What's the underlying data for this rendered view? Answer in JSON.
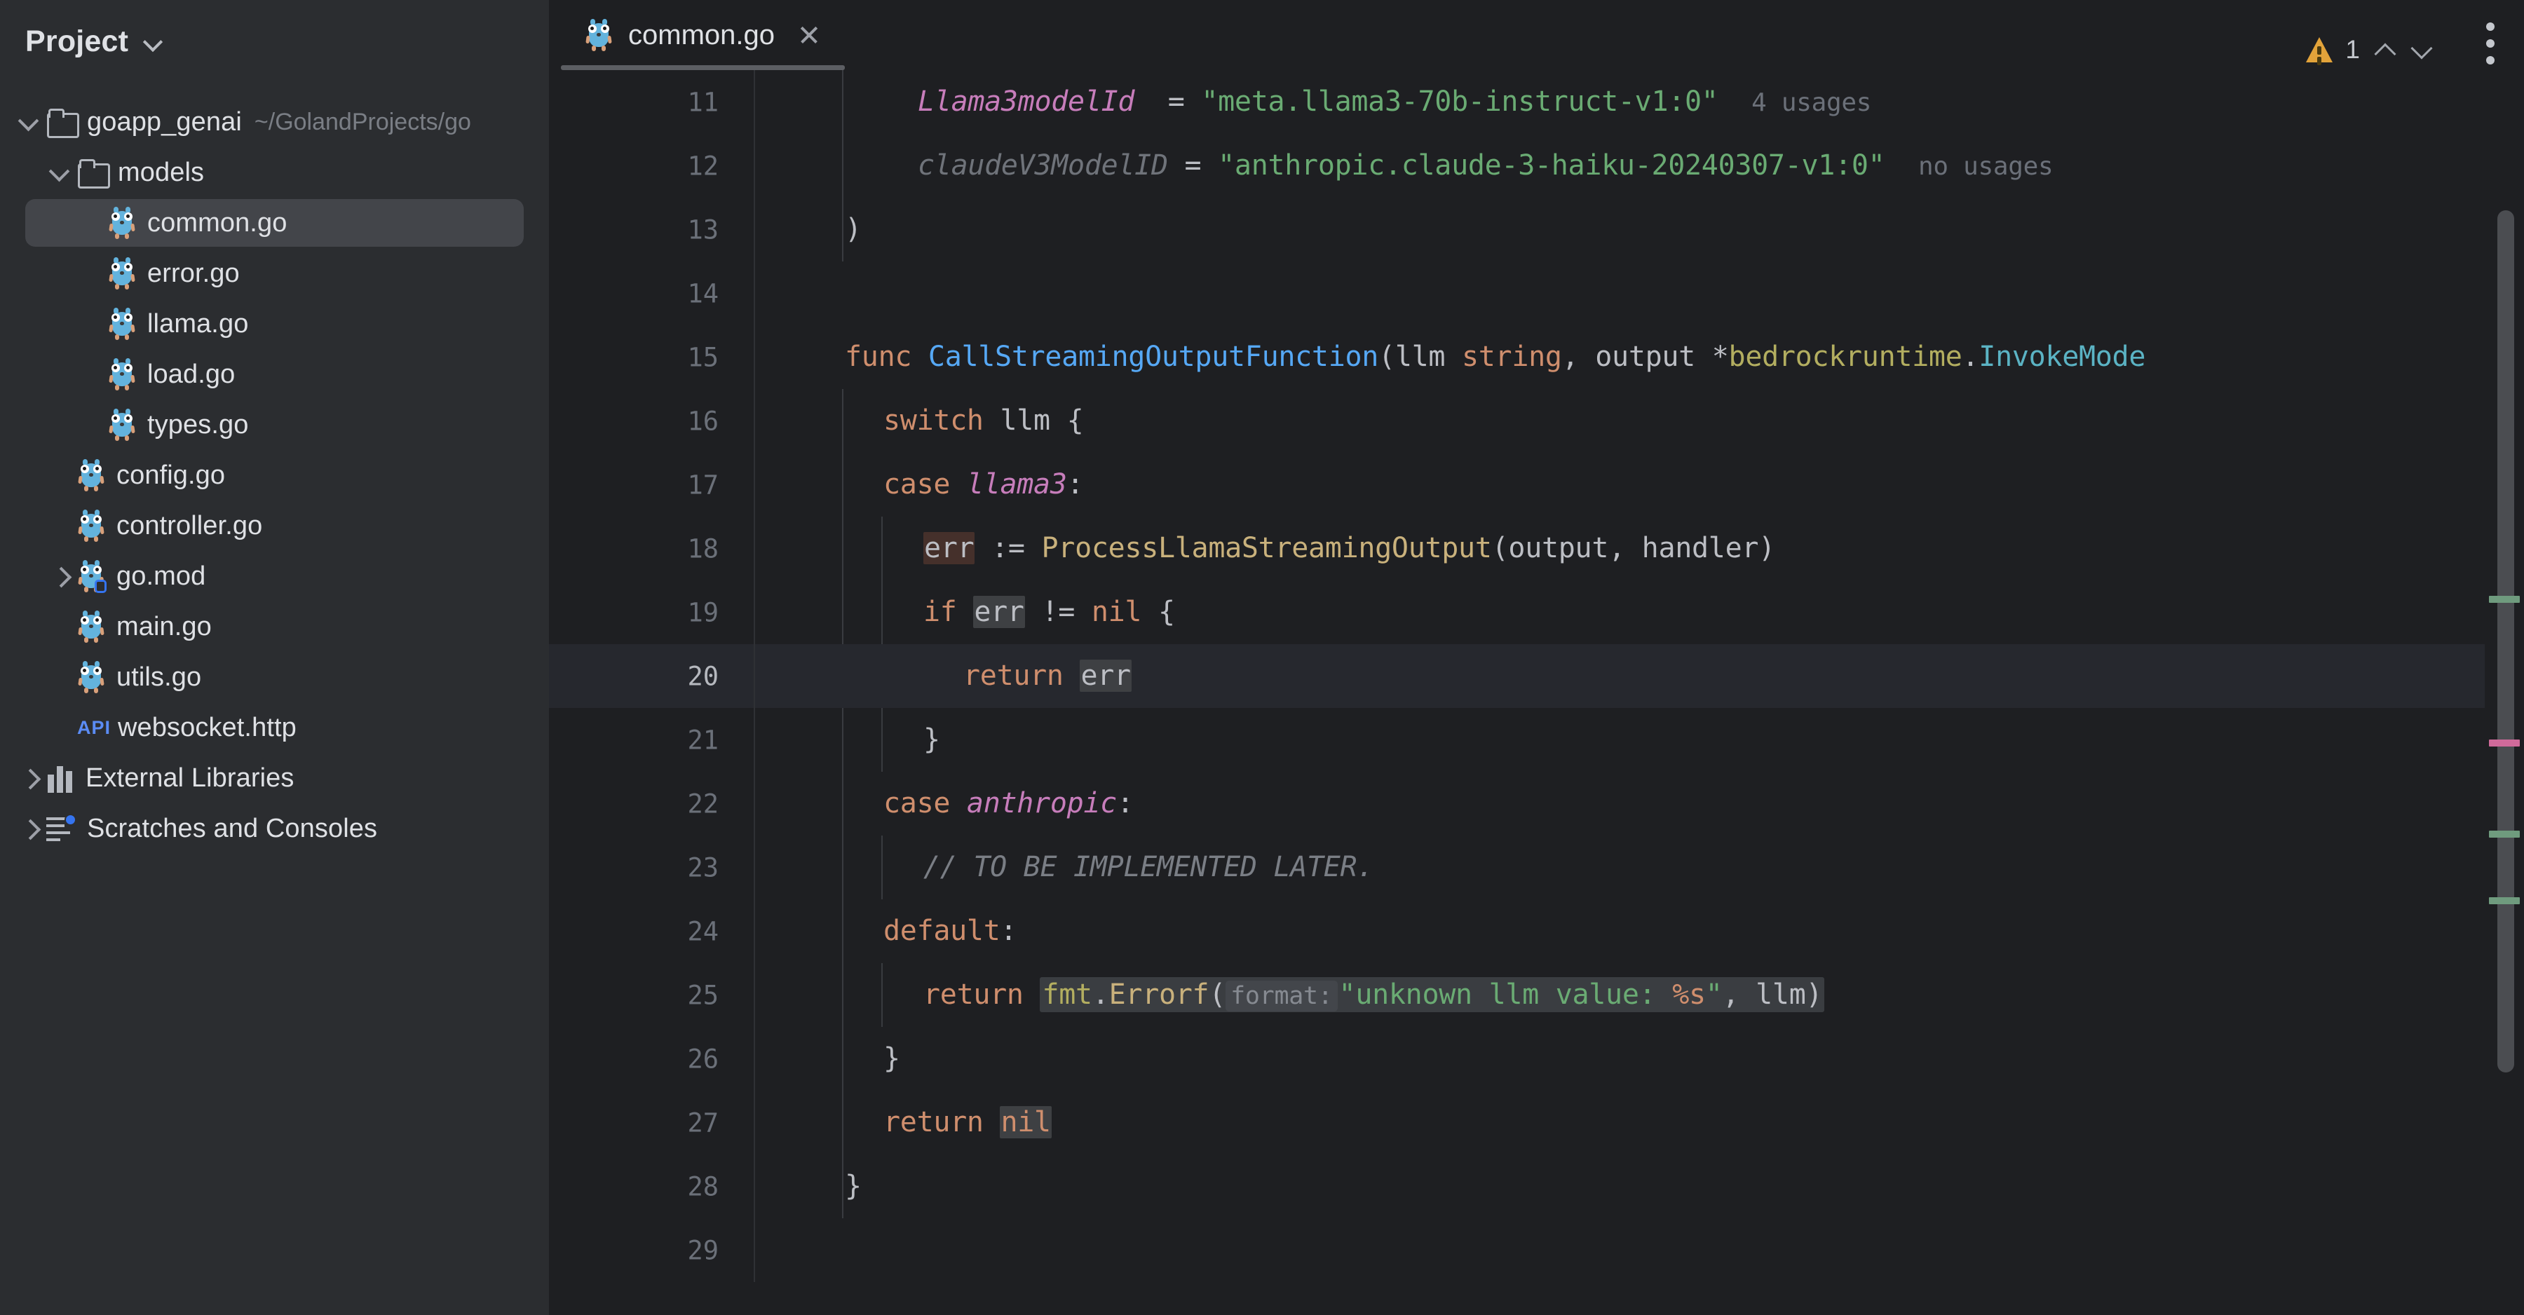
{
  "sidebar": {
    "title": "Project",
    "title_chevron_icon": "chevron-down-icon",
    "tree": [
      {
        "label": "goapp_genai",
        "sub": "~/GolandProjects/go",
        "icon": "folder-icon",
        "twisty": "open",
        "depth": 0,
        "selected": false
      },
      {
        "label": "models",
        "sub": "",
        "icon": "folder-icon",
        "twisty": "open",
        "depth": 1,
        "selected": false
      },
      {
        "label": "common.go",
        "sub": "",
        "icon": "gopher-icon",
        "twisty": "none",
        "depth": 2,
        "selected": true
      },
      {
        "label": "error.go",
        "sub": "",
        "icon": "gopher-icon",
        "twisty": "none",
        "depth": 2,
        "selected": false
      },
      {
        "label": "llama.go",
        "sub": "",
        "icon": "gopher-icon",
        "twisty": "none",
        "depth": 2,
        "selected": false
      },
      {
        "label": "load.go",
        "sub": "",
        "icon": "gopher-icon",
        "twisty": "none",
        "depth": 2,
        "selected": false
      },
      {
        "label": "types.go",
        "sub": "",
        "icon": "gopher-icon",
        "twisty": "none",
        "depth": 2,
        "selected": false
      },
      {
        "label": "config.go",
        "sub": "",
        "icon": "gopher-icon",
        "twisty": "none",
        "depth": 1,
        "selected": false
      },
      {
        "label": "controller.go",
        "sub": "",
        "icon": "gopher-icon",
        "twisty": "none",
        "depth": 1,
        "selected": false
      },
      {
        "label": "go.mod",
        "sub": "",
        "icon": "gomod-icon",
        "twisty": "closed",
        "depth": 1,
        "selected": false
      },
      {
        "label": "main.go",
        "sub": "",
        "icon": "gopher-icon",
        "twisty": "none",
        "depth": 1,
        "selected": false
      },
      {
        "label": "utils.go",
        "sub": "",
        "icon": "gopher-icon",
        "twisty": "none",
        "depth": 1,
        "selected": false
      },
      {
        "label": "websocket.http",
        "sub": "",
        "icon": "api-icon",
        "twisty": "none",
        "depth": 1,
        "selected": false
      },
      {
        "label": "External Libraries",
        "sub": "",
        "icon": "library-icon",
        "twisty": "closed",
        "depth": 0,
        "selected": false
      },
      {
        "label": "Scratches and Consoles",
        "sub": "",
        "icon": "scratch-icon",
        "twisty": "closed",
        "depth": 0,
        "selected": false
      }
    ]
  },
  "editor": {
    "tab": {
      "label": "common.go",
      "icon": "gopher-icon",
      "close_icon": "close-icon"
    },
    "kebab_icon": "more-options-icon",
    "inspection_widget": {
      "warning_icon": "warning-triangle-icon",
      "count": "1",
      "prev_icon": "chevron-up-icon",
      "next_icon": "chevron-down-icon"
    },
    "lines": [
      {
        "n": "11",
        "current": false
      },
      {
        "n": "12",
        "current": false
      },
      {
        "n": "13",
        "current": false
      },
      {
        "n": "14",
        "current": false
      },
      {
        "n": "15",
        "current": false
      },
      {
        "n": "16",
        "current": false
      },
      {
        "n": "17",
        "current": false
      },
      {
        "n": "18",
        "current": false
      },
      {
        "n": "19",
        "current": false
      },
      {
        "n": "20",
        "current": true
      },
      {
        "n": "21",
        "current": false
      },
      {
        "n": "22",
        "current": false
      },
      {
        "n": "23",
        "current": false
      },
      {
        "n": "24",
        "current": false
      },
      {
        "n": "25",
        "current": false
      },
      {
        "n": "26",
        "current": false
      },
      {
        "n": "27",
        "current": false
      },
      {
        "n": "28",
        "current": false
      },
      {
        "n": "29",
        "current": false
      }
    ],
    "code": {
      "l11_name": "Llama3modelId",
      "l11_eq": " = ",
      "l11_str": "\"meta.llama3-70b-instruct-v1:0\"",
      "l11_usages": "4 usages",
      "l12_name": "claudeV3ModelID",
      "l12_eq": " = ",
      "l12_str": "\"anthropic.claude-3-haiku-20240307-v1:0\"",
      "l12_usages": "no usages",
      "l13": ")",
      "l15_func": "func ",
      "l15_name": "CallStreamingOutputFunction",
      "l15_open": "(",
      "l15_p1": "llm ",
      "l15_t1": "string",
      "l15_comma": ", ",
      "l15_p2": "output ",
      "l15_star": "*",
      "l15_pkg": "bedrockruntime",
      "l15_dot": ".",
      "l15_type": "InvokeMode",
      "l16_kw": "switch ",
      "l16_rest": "llm {",
      "l17_kw": "case ",
      "l17_cnst": "llama3",
      "l17_colon": ":",
      "l18_err": "err",
      "l18_assign": " := ",
      "l18_call": "ProcessLlamaStreamingOutput",
      "l18_args": "(output, handler)",
      "l19_if": "if ",
      "l19_err": "err",
      "l19_neq": " != ",
      "l19_nil": "nil",
      "l19_brace": " {",
      "l20_kw": "return ",
      "l20_err": "err",
      "l21": "}",
      "l22_kw": "case ",
      "l22_cnst": "anthropic",
      "l22_colon": ":",
      "l23_cmt": "// TO BE IMPLEMENTED LATER.",
      "l24_kw": "default",
      "l24_colon": ":",
      "l25_kw": "return ",
      "l25_pkg": "fmt",
      "l25_dot": ".",
      "l25_fn": "Errorf",
      "l25_open": "(",
      "l25_inlay": "format:",
      "l25_str": "\"unknown llm value: %s\"",
      "l25_tail": ", llm)",
      "l26": "}",
      "l27_kw": "return ",
      "l27_nil": "nil",
      "l28": "}"
    },
    "scrollbar": {
      "markers": [
        {
          "kind": "usage",
          "color": "#6f9b7e"
        },
        {
          "kind": "caret",
          "color": "#d06a9a"
        },
        {
          "kind": "usage",
          "color": "#6f9b7e"
        },
        {
          "kind": "usage",
          "color": "#6f9b7e"
        }
      ]
    }
  },
  "colors": {
    "bg_editor": "#1e1f22",
    "bg_sidebar": "#2b2d30",
    "selection": "#43454a",
    "current_line": "#26282e",
    "keyword": "#cf8e6d",
    "string": "#6aab73",
    "constant": "#c77dbb",
    "function": "#56a8f5",
    "type": "#5bb3c4",
    "package": "#b3ae60",
    "comment": "#7a7e85",
    "warning": "#e3a33a"
  }
}
